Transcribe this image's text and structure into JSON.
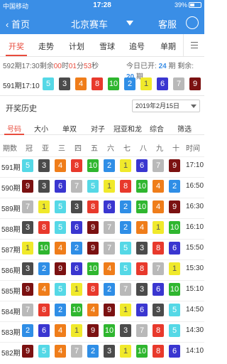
{
  "status": {
    "carrier": "中国移动",
    "time": "17:28",
    "battery": "39%"
  },
  "nav": {
    "back_label": "首页",
    "title": "北京赛车",
    "service_label": "客服"
  },
  "tabs": [
    {
      "label": "开奖",
      "active": true
    },
    {
      "label": "走势",
      "active": false
    },
    {
      "label": "计划",
      "active": false
    },
    {
      "label": "雪球",
      "active": false
    },
    {
      "label": "追号",
      "active": false
    },
    {
      "label": "单期",
      "active": false
    }
  ],
  "countdown": {
    "prefix": "592期17:30剩余",
    "h": "00",
    "h_unit": "时",
    "m": "01",
    "m_unit": "分",
    "s": "53",
    "s_unit": "秒",
    "today_opened_label": "今日已开:",
    "today_opened": "24",
    "period_unit": "期",
    "remaining_label": "剩余:",
    "remaining": "20",
    "remaining_unit": "期"
  },
  "latest": {
    "label": "591期17:10",
    "balls": [
      5,
      3,
      4,
      8,
      10,
      2,
      1,
      6,
      7,
      9
    ]
  },
  "history": {
    "title": "开奖历史",
    "date": "2019年2月15日",
    "filters": [
      "号码",
      "大小",
      "单双",
      "对子",
      "冠亚和龙",
      "综合",
      "筛选"
    ],
    "columns": [
      "期数",
      "冠",
      "亚",
      "三",
      "四",
      "五",
      "六",
      "七",
      "八",
      "九",
      "十",
      "时间"
    ],
    "rows": [
      {
        "issue": "591期",
        "balls": [
          5,
          3,
          4,
          8,
          10,
          2,
          1,
          6,
          7,
          9
        ],
        "time": "17:10"
      },
      {
        "issue": "590期",
        "balls": [
          9,
          3,
          6,
          7,
          5,
          1,
          8,
          10,
          4,
          2
        ],
        "time": "16:50"
      },
      {
        "issue": "589期",
        "balls": [
          7,
          1,
          5,
          3,
          8,
          6,
          2,
          10,
          4,
          9
        ],
        "time": "16:30"
      },
      {
        "issue": "588期",
        "balls": [
          3,
          8,
          5,
          6,
          9,
          7,
          2,
          4,
          1,
          10
        ],
        "time": "16:10"
      },
      {
        "issue": "587期",
        "balls": [
          1,
          10,
          4,
          2,
          9,
          7,
          5,
          3,
          8,
          6
        ],
        "time": "15:50"
      },
      {
        "issue": "586期",
        "balls": [
          3,
          2,
          9,
          6,
          10,
          4,
          5,
          8,
          7,
          1
        ],
        "time": "15:30"
      },
      {
        "issue": "585期",
        "balls": [
          9,
          4,
          5,
          1,
          8,
          2,
          7,
          3,
          6,
          10
        ],
        "time": "15:10"
      },
      {
        "issue": "584期",
        "balls": [
          7,
          8,
          2,
          10,
          4,
          9,
          1,
          6,
          3,
          5
        ],
        "time": "14:50"
      },
      {
        "issue": "583期",
        "balls": [
          2,
          6,
          4,
          1,
          9,
          10,
          3,
          7,
          8,
          5
        ],
        "time": "14:30"
      },
      {
        "issue": "582期",
        "balls": [
          9,
          5,
          4,
          7,
          2,
          3,
          1,
          10,
          8,
          6
        ],
        "time": "14:10"
      }
    ]
  },
  "colors": {
    "1": "#f0e92b",
    "2": "#2f8ee6",
    "3": "#4b4b4b",
    "4": "#ef7d1a",
    "5": "#55d8e6",
    "6": "#3a36d0",
    "7": "#b9b9b9",
    "8": "#e8392c",
    "9": "#7b1111",
    "10": "#2fb62f",
    "accent": "#3a8ee6",
    "highlight": "#e84c3d"
  }
}
